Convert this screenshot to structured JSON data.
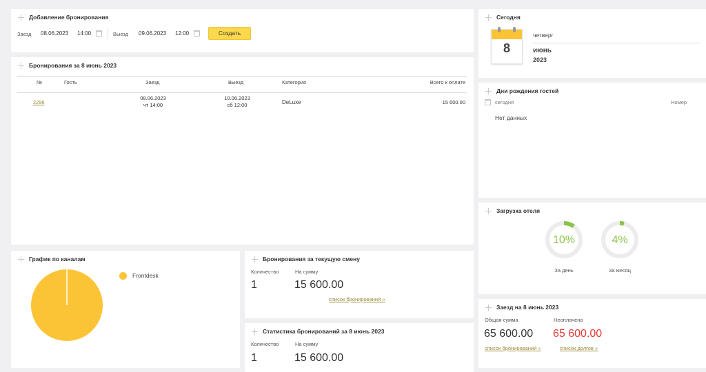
{
  "add_booking": {
    "title": "Добавление бронирования",
    "checkin_label": "Заезд",
    "checkin_date": "08.06.2023",
    "checkin_time": "14:00",
    "checkout_label": "Выезд",
    "checkout_date": "09.06.2023",
    "checkout_time": "12:00",
    "create_button": "Создать"
  },
  "bookings": {
    "title": "Бронирования за 8 июнь 2023",
    "columns": [
      "№",
      "Гость",
      "Заезд",
      "Выезд",
      "Категория",
      "Всего к оплате"
    ],
    "rows": [
      {
        "id": "2296",
        "guest": "",
        "checkin_date": "08.06.2023",
        "checkin_day": "чт 14:00",
        "checkout_date": "10.06.2023",
        "checkout_day": "сб 12:00",
        "category": "DeLuxe",
        "total": "15 600.00"
      }
    ]
  },
  "today": {
    "title": "Сегодня",
    "day_number": "8",
    "weekday": "четверг",
    "month": "июнь",
    "year": "2023"
  },
  "birthdays": {
    "title": "Дни рождения гостей",
    "period": "сегодня",
    "room_header": "Номер",
    "empty": "Нет данных"
  },
  "load": {
    "title": "Загрузка отеля",
    "day_value": "10%",
    "day_fraction": 0.1,
    "day_label": "За день",
    "month_value": "4%",
    "month_fraction": 0.04,
    "month_label": "За месяц",
    "accent": "#8bc34a"
  },
  "channels": {
    "title": "График по каналам",
    "legend": "Frontdesk",
    "color": "#fbc437"
  },
  "chart_data": {
    "type": "pie",
    "title": "График по каналам",
    "categories": [
      "Frontdesk"
    ],
    "values": [
      100
    ],
    "colors": [
      "#fbc437"
    ],
    "legend": "top-right"
  },
  "shift": {
    "title": "Бронирования за текущую смену",
    "count_label": "Количество",
    "count": "1",
    "sum_label": "На сумму",
    "sum": "15 600.00",
    "link": "список бронирований »"
  },
  "stats": {
    "title": "Статистика бронирований за 8 июнь 2023",
    "count_label": "Количество",
    "count": "1",
    "sum_label": "На сумму",
    "sum": "15 600.00"
  },
  "checkin_today": {
    "title": "Заезд на 8 июнь 2023",
    "total_label": "Общая сумма",
    "total": "65 600.00",
    "unpaid_label": "Неоплачено",
    "unpaid": "65 600.00",
    "bookings_link": "список бронирований »",
    "debts_link": "список долгов »",
    "unpaid_color": "#e53935"
  }
}
